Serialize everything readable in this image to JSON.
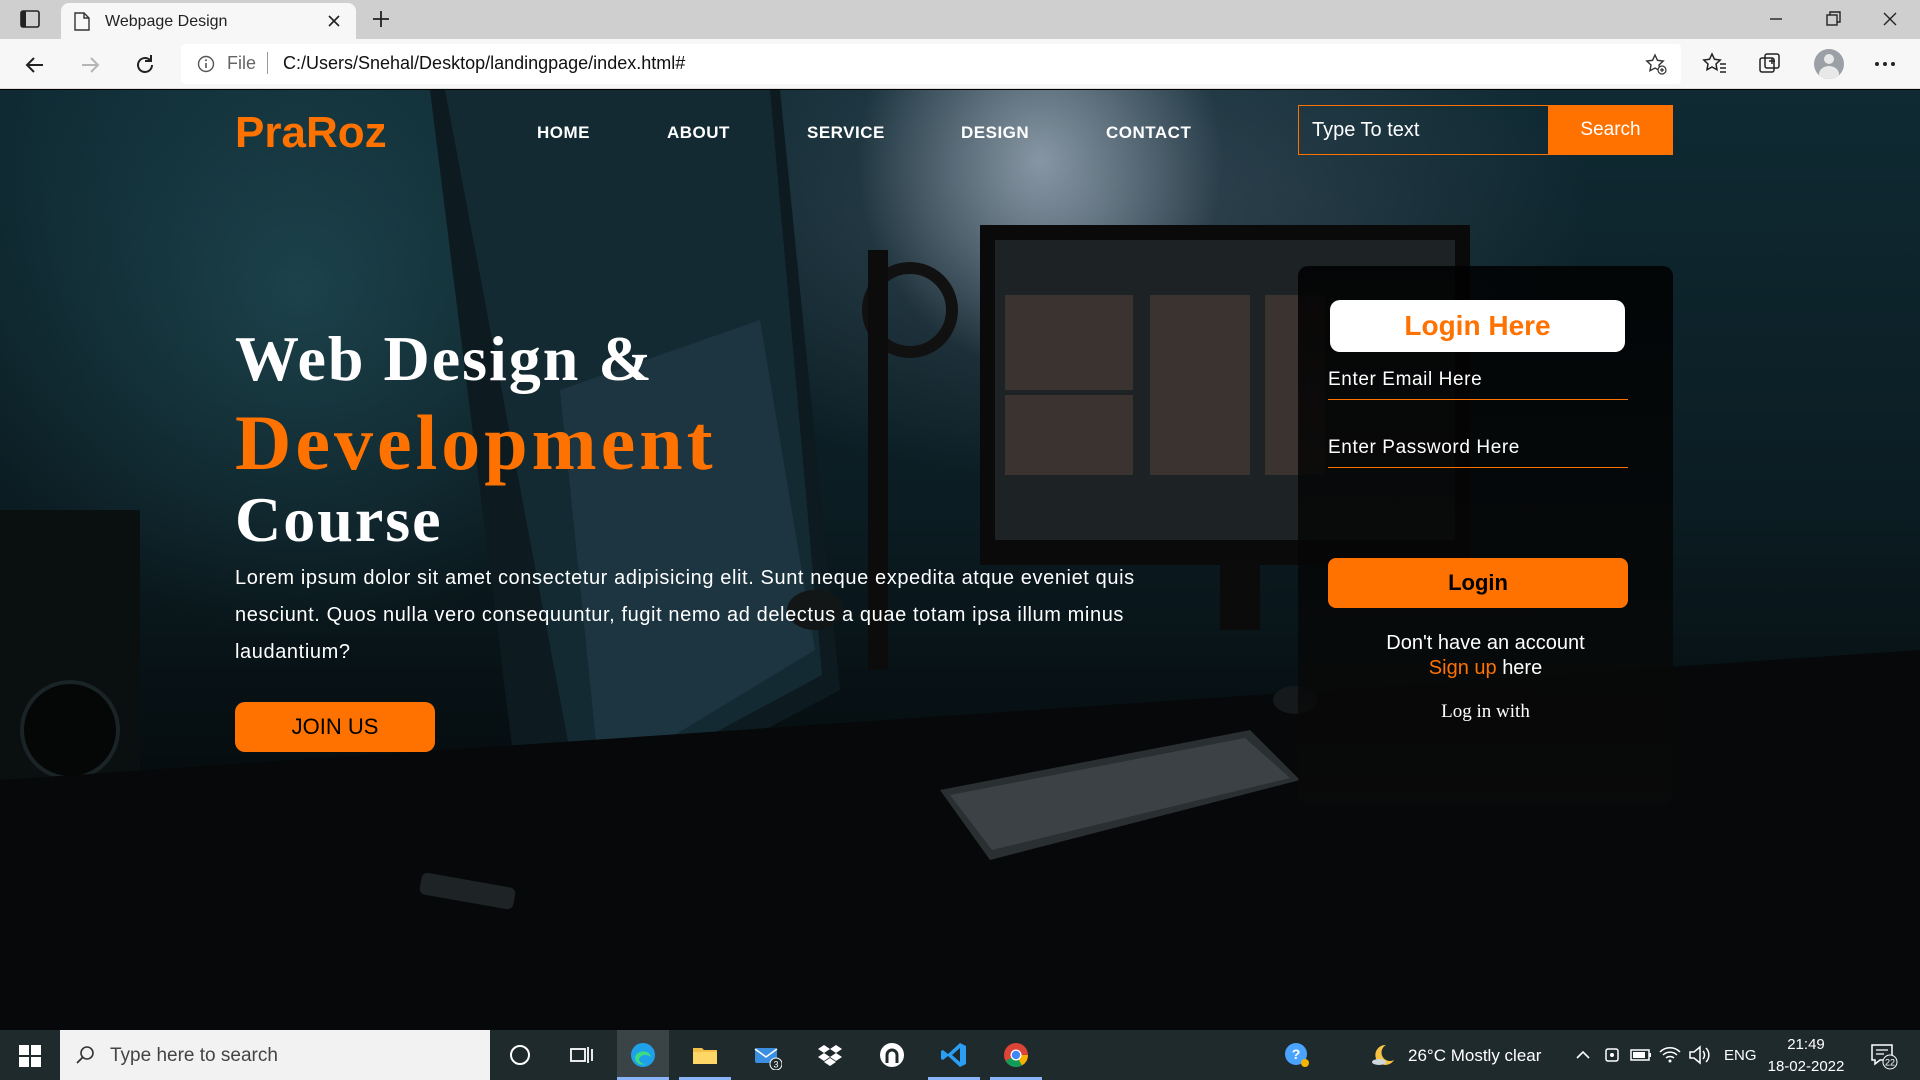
{
  "browser": {
    "tab_title": "Webpage Design",
    "file_label": "File",
    "url": "C:/Users/Snehal/Desktop/landingpage/index.html#"
  },
  "site": {
    "logo": "PraRoz",
    "menu": [
      "HOME",
      "ABOUT",
      "SERVICE",
      "DESIGN",
      "CONTACT"
    ],
    "search": {
      "placeholder": "Type To text",
      "button": "Search"
    },
    "hero": {
      "line1": "Web Design &",
      "line2": "Development",
      "line3": "Course",
      "paragraph": "Lorem ipsum dolor sit amet consectetur adipisicing elit. Sunt neque expedita atque eveniet quis nesciunt. Quos nulla vero consequuntur, fugit nemo ad delectus a quae totam ipsa illum minus laudantium?",
      "join_button": "JOIN US"
    },
    "login": {
      "title": "Login Here",
      "email_placeholder": "Enter Email Here",
      "password_placeholder": "Enter Password Here",
      "button": "Login",
      "no_account": "Don't have an account",
      "signup_link": "Sign up",
      "signup_suffix": "here",
      "login_with": "Log in with"
    },
    "accent_color": "#ff7200"
  },
  "taskbar": {
    "search_placeholder": "Type here to search",
    "mail_badge": "3",
    "weather": "26°C  Mostly clear",
    "language": "ENG",
    "time": "21:49",
    "date": "18-02-2022",
    "notifications": "22"
  }
}
